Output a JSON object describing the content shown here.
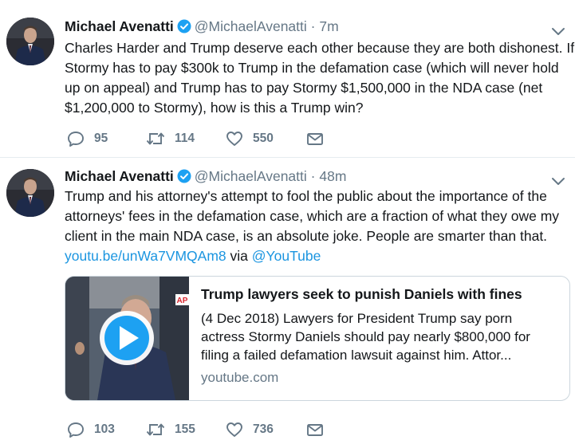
{
  "tweets": [
    {
      "name": "Michael Avenatti",
      "handle": "@MichaelAvenatti",
      "separator": "·",
      "time": "7m",
      "text_lines": [
        "Charles Harder and Trump deserve each other because they are both dishonest. If",
        "Stormy has to pay $300k to Trump in the defamation case (which will never hold",
        "up on appeal) and Trump has to pay Stormy $1,500,000 in the NDA case (net",
        "$1,200,000 to Stormy), how is this a Trump win?"
      ],
      "replies": "95",
      "retweets": "114",
      "likes": "550"
    },
    {
      "name": "Michael Avenatti",
      "handle": "@MichaelAvenatti",
      "separator": "·",
      "time": "48m",
      "text_lines": [
        "Trump and his attorney's attempt to fool the public about the importance of the",
        "attorneys' fees in the defamation case, which are a fraction of what they owe my",
        "client in the main NDA case, is an absolute joke. People are smarter than that."
      ],
      "link_text": "youtu.be/unWa7VMQAm8",
      "via_text": "via",
      "mention": "@YouTube",
      "card": {
        "title": "Trump lawyers seek to punish Daniels with fines",
        "desc_lines": [
          "(4 Dec 2018) Lawyers for President Trump say porn",
          "actress Stormy Daniels should pay nearly $800,000 for",
          "filing a failed defamation lawsuit against him. Attor..."
        ],
        "domain": "youtube.com",
        "ap_badge": "AP"
      },
      "replies": "103",
      "retweets": "155",
      "likes": "736"
    }
  ],
  "colors": {
    "link": "#1b95e0",
    "muted": "#657786",
    "verified": "#1da1f2",
    "divider": "#e6ecf0"
  },
  "icons": {
    "reply": "reply-icon",
    "retweet": "retweet-icon",
    "like": "heart-icon",
    "dm": "envelope-icon",
    "verified": "verified-badge-icon",
    "caret": "chevron-down-icon",
    "play": "play-icon"
  }
}
